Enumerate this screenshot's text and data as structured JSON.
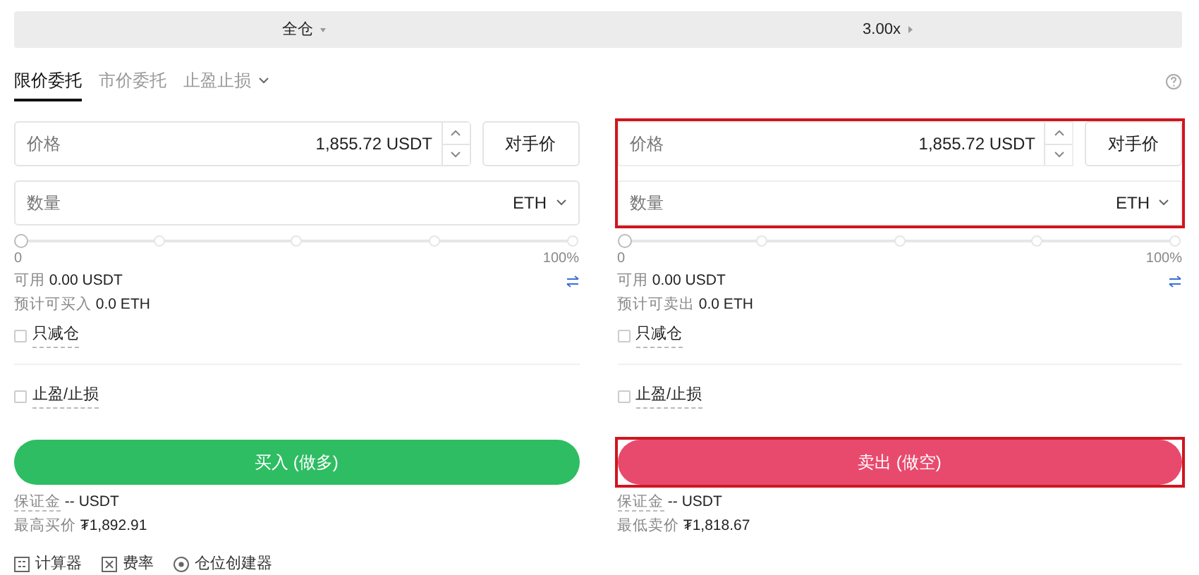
{
  "top_bar": {
    "margin_mode": "全仓",
    "leverage": "3.00x"
  },
  "order_tabs": [
    {
      "label": "限价委托",
      "selected": true,
      "dropdown": false
    },
    {
      "label": "市价委托",
      "selected": false,
      "dropdown": false
    },
    {
      "label": "止盈止损",
      "selected": false,
      "dropdown": true
    }
  ],
  "panels": [
    {
      "color": "#2ebd62",
      "highlighted": false,
      "price_label": "价格",
      "price_value": "1,855.72",
      "price_unit": "USDT",
      "counter_price_button": "对手价",
      "quantity_label": "数量",
      "quantity_unit": "ETH",
      "slider": {
        "level": 0,
        "min_label": "0",
        "max_label": "100%"
      },
      "available_label": "可用",
      "available_value": "0.00 USDT",
      "estimate_label": "预计可买入",
      "estimate_value": "0.0 ETH",
      "reduce_only": {
        "label": "只减仓",
        "checked": false
      },
      "tp_sl": {
        "label": "止盈/止损",
        "checked": false
      },
      "submit_button": "买入 (做多)",
      "margin_label": "保证金",
      "margin_value": "-- USDT",
      "limit_label": "最高买价",
      "limit_value": "₮1,892.91"
    },
    {
      "color": "#e84a6e",
      "highlighted": true,
      "price_label": "价格",
      "price_value": "1,855.72",
      "price_unit": "USDT",
      "counter_price_button": "对手价",
      "quantity_label": "数量",
      "quantity_unit": "ETH",
      "slider": {
        "level": 0,
        "min_label": "0",
        "max_label": "100%"
      },
      "available_label": "可用",
      "available_value": "0.00 USDT",
      "estimate_label": "预计可卖出",
      "estimate_value": "0.0 ETH",
      "reduce_only": {
        "label": "只减仓",
        "checked": false
      },
      "tp_sl": {
        "label": "止盈/止损",
        "checked": false
      },
      "submit_button": "卖出 (做空)",
      "margin_label": "保证金",
      "margin_value": "-- USDT",
      "limit_label": "最低卖价",
      "limit_value": "₮1,818.67"
    }
  ],
  "tools": [
    {
      "kind": "calculator",
      "label": "计算器"
    },
    {
      "kind": "fee",
      "label": "费率"
    },
    {
      "kind": "position",
      "label": "仓位创建器"
    }
  ]
}
